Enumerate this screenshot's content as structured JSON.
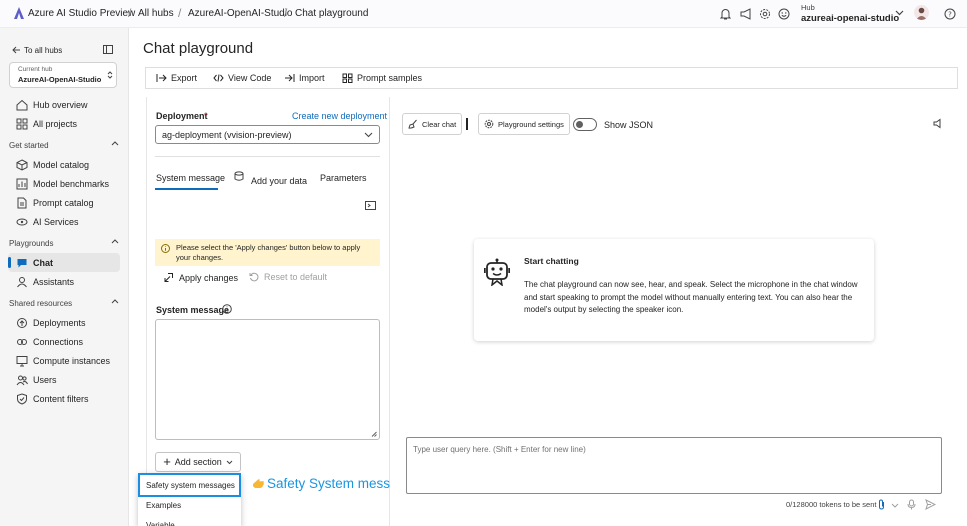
{
  "topbar": {
    "brand": "Azure AI Studio Preview",
    "breadcrumbs": [
      "All hubs",
      "AzureAI-OpenAI-Studio",
      "Chat playground"
    ],
    "hub_label": "Hub",
    "hub_name": "azureai-openai-studio",
    "icons": [
      "bell-icon",
      "megaphone-icon",
      "gear-icon",
      "smiley-icon",
      "avatar",
      "help-icon"
    ]
  },
  "sidebar": {
    "back_label": "To all hubs",
    "current_hub_label": "Current hub",
    "current_hub_name": "AzureAI-OpenAI-Studio",
    "top_items": [
      {
        "label": "Hub overview",
        "icon": "home-icon"
      },
      {
        "label": "All projects",
        "icon": "grid-icon"
      }
    ],
    "sections": [
      {
        "title": "Get started",
        "items": [
          {
            "label": "Model catalog",
            "icon": "cube-icon"
          },
          {
            "label": "Model benchmarks",
            "icon": "chart-icon"
          },
          {
            "label": "Prompt catalog",
            "icon": "document-icon"
          },
          {
            "label": "AI Services",
            "icon": "sparkle-icon"
          }
        ]
      },
      {
        "title": "Playgrounds",
        "items": [
          {
            "label": "Chat",
            "icon": "chat-icon",
            "selected": true
          },
          {
            "label": "Assistants",
            "icon": "assistant-icon"
          }
        ]
      },
      {
        "title": "Shared resources",
        "items": [
          {
            "label": "Deployments",
            "icon": "deploy-icon"
          },
          {
            "label": "Connections",
            "icon": "link-icon"
          },
          {
            "label": "Compute instances",
            "icon": "compute-icon"
          },
          {
            "label": "Users",
            "icon": "users-icon"
          },
          {
            "label": "Content filters",
            "icon": "shield-icon"
          }
        ]
      }
    ]
  },
  "page": {
    "title": "Chat playground"
  },
  "toolbar": {
    "export": "Export",
    "view_code": "View Code",
    "import": "Import",
    "prompt_samples": "Prompt samples"
  },
  "setup": {
    "deployment_label": "Deployment",
    "required_mark": "*",
    "create_link": "Create new deployment",
    "deployment_value": "ag-deployment (vvision-preview)",
    "tabs": [
      "System message",
      "Add your data",
      "Parameters"
    ],
    "active_tab": "System message",
    "warning": "Please select the 'Apply changes' button below to apply your changes.",
    "apply_changes": "Apply changes",
    "reset_default": "Reset to default",
    "system_message_label": "System message",
    "system_message_value": "",
    "add_section": "Add section",
    "dropdown_items": [
      "Safety system messages",
      "Examples",
      "Variable"
    ]
  },
  "callout": {
    "text": "Safety System messages is here!",
    "accent": "#1a95e0"
  },
  "chat": {
    "clear_chat": "Clear chat",
    "playground_settings": "Playground settings",
    "show_json": "Show JSON",
    "show_json_on": false,
    "card_title": "Start chatting",
    "card_body": "The chat playground can now see, hear, and speak. Select the microphone in the chat window and start speaking to prompt the model without manually entering text. You can also hear the model's output by selecting the speaker icon.",
    "query_placeholder": "Type user query here. (Shift + Enter for new line)",
    "tokens": "0/128000 tokens to be sent"
  },
  "colors": {
    "brand": "#0f6cbd",
    "highlight_border": "#1b8de3",
    "warning_bg": "#fff4ce"
  }
}
